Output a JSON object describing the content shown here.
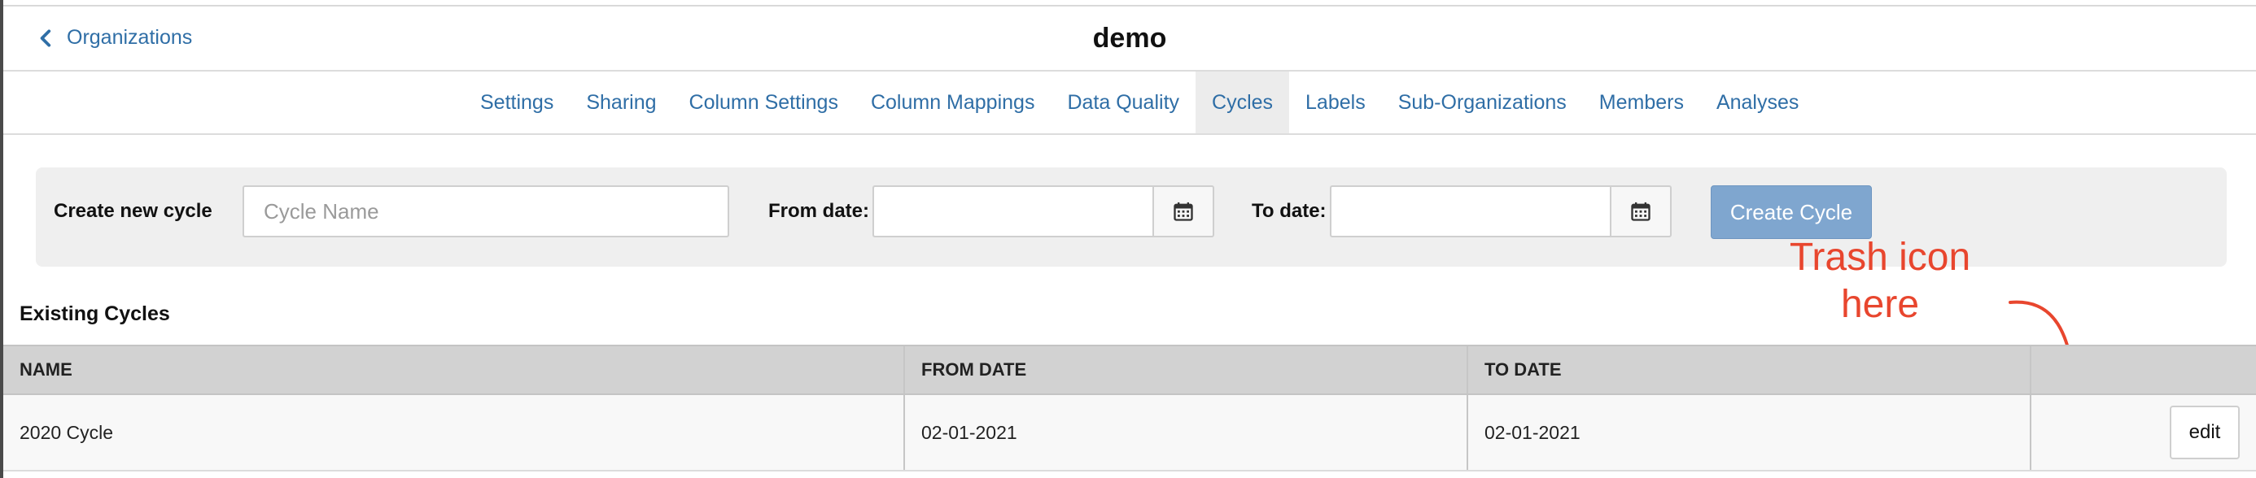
{
  "header": {
    "back_label": "Organizations",
    "title": "demo"
  },
  "tabs": [
    {
      "label": "Settings"
    },
    {
      "label": "Sharing"
    },
    {
      "label": "Column Settings"
    },
    {
      "label": "Column Mappings"
    },
    {
      "label": "Data Quality"
    },
    {
      "label": "Cycles",
      "active": true
    },
    {
      "label": "Labels"
    },
    {
      "label": "Sub-Organizations"
    },
    {
      "label": "Members"
    },
    {
      "label": "Analyses"
    }
  ],
  "create_form": {
    "label": "Create new cycle",
    "name_placeholder": "Cycle Name",
    "name_value": "",
    "from_label": "From date:",
    "from_value": "",
    "to_label": "To date:",
    "to_value": "",
    "submit_label": "Create Cycle"
  },
  "annotation": {
    "text": "Trash icon\nhere",
    "color": "#e8462e"
  },
  "existing": {
    "title": "Existing Cycles",
    "columns": [
      "NAME",
      "FROM DATE",
      "TO DATE",
      ""
    ],
    "rows": [
      {
        "name": "2020 Cycle",
        "from": "02-01-2021",
        "to": "02-01-2021",
        "action_label": "edit"
      }
    ]
  },
  "colors": {
    "link": "#2f6ea6",
    "primary_button": "#7fa6cf",
    "panel_bg": "#efefef",
    "table_header_bg": "#d2d2d2"
  },
  "icons": {
    "back": "chevron-left-icon",
    "date_picker": "calendar-icon"
  }
}
